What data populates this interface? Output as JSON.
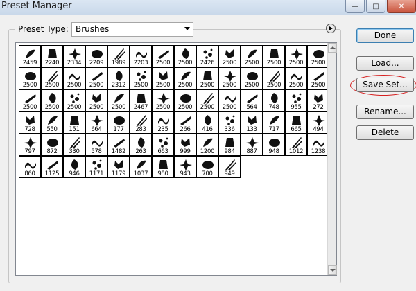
{
  "window": {
    "title": "Preset Manager"
  },
  "preset_type": {
    "label": "Preset Type:",
    "selected": "Brushes"
  },
  "buttons": {
    "done": "Done",
    "load": "Load...",
    "save_set": "Save Set...",
    "rename": "Rename...",
    "delete": "Delete"
  },
  "brush_sizes": [
    "2459",
    "2240",
    "2334",
    "2209",
    "1989",
    "2203",
    "2500",
    "2500",
    "2426",
    "2500",
    "2500",
    "2500",
    "2500",
    "2500",
    "2500",
    "2500",
    "2500",
    "2500",
    "2312",
    "2500",
    "2500",
    "2500",
    "2500",
    "2500",
    "2500",
    "2500",
    "2500",
    "2500",
    "2500",
    "2500",
    "2500",
    "2500",
    "2500",
    "2467",
    "2500",
    "2500",
    "2500",
    "2500",
    "564",
    "748",
    "955",
    "272",
    "728",
    "550",
    "151",
    "664",
    "177",
    "283",
    "235",
    "266",
    "416",
    "336",
    "133",
    "717",
    "665",
    "494",
    "797",
    "872",
    "330",
    "578",
    "1482",
    "263",
    "663",
    "999",
    "1200",
    "984",
    "887",
    "948",
    "1012",
    "1238",
    "860",
    "1125",
    "946",
    "1171",
    "1179",
    "1037",
    "980",
    "943",
    "700",
    "949"
  ]
}
